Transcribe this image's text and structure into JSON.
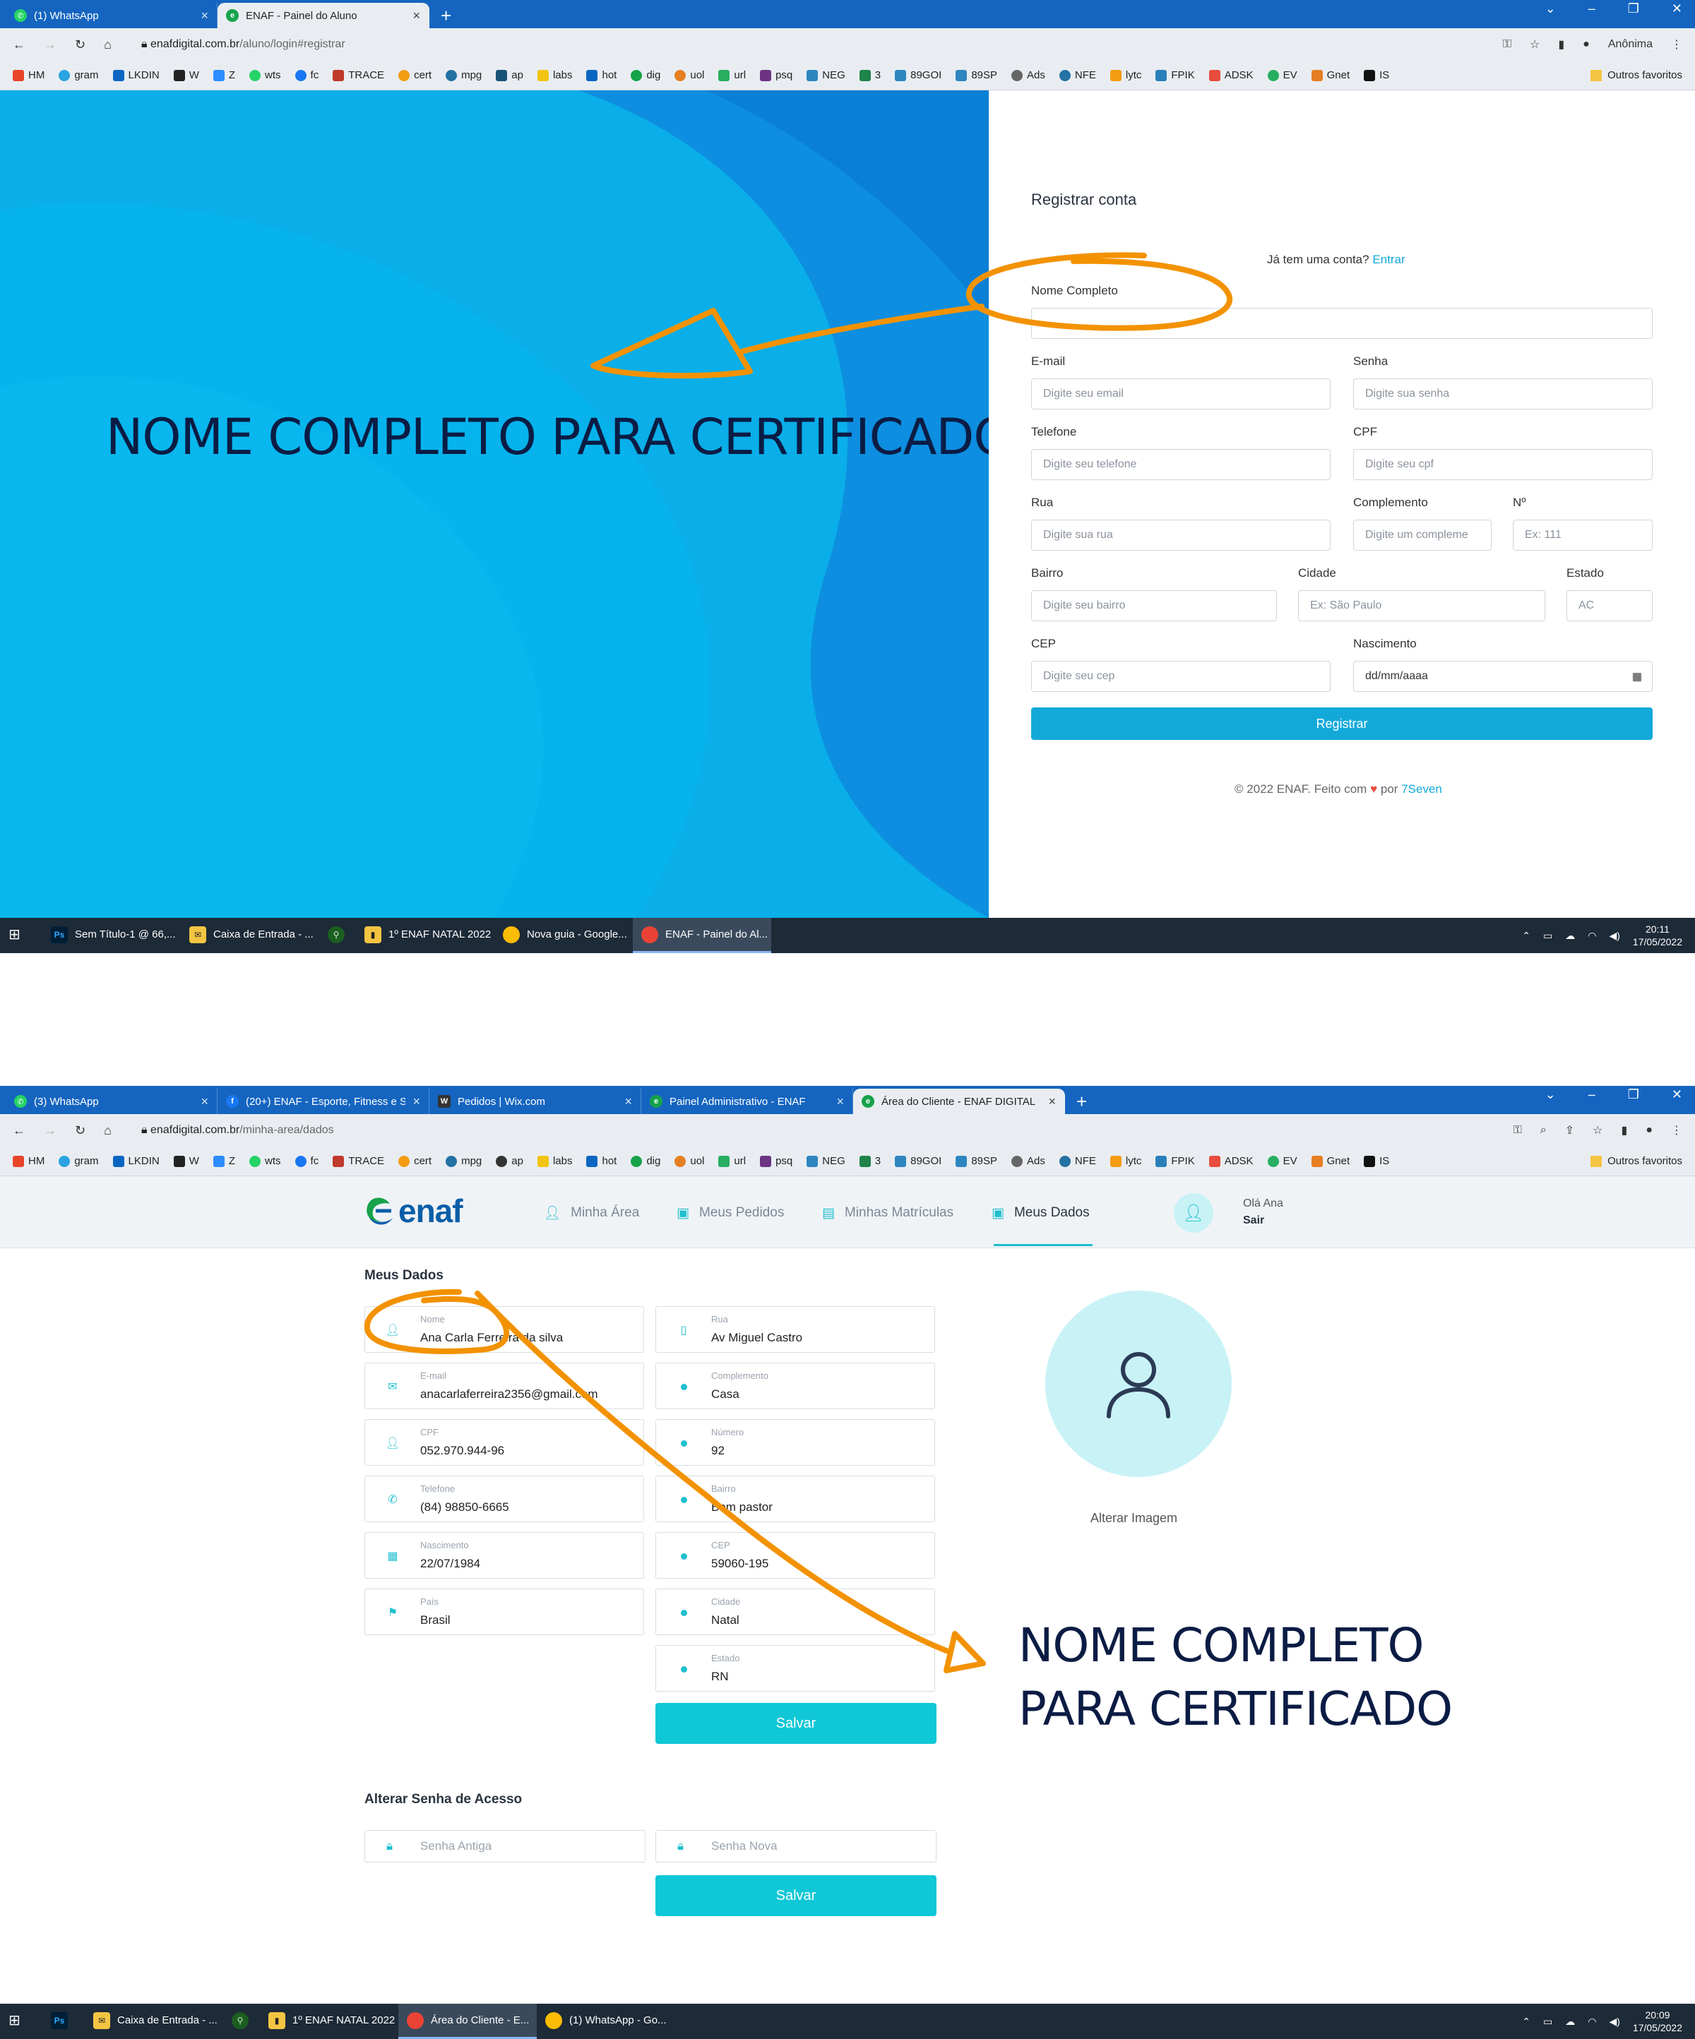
{
  "screenshot1": {
    "browser": {
      "tabs": [
        {
          "label": "(1) WhatsApp",
          "color": "#25d366"
        },
        {
          "label": "ENAF - Painel do Aluno",
          "color": "#16a34a"
        }
      ],
      "url_domain": "enafdigital.com.br",
      "url_path": "/aluno/login#registrar",
      "profile_label": "Anônima"
    },
    "form": {
      "title": "Registrar conta",
      "have_account": "Já tem uma conta?",
      "login_link": "Entrar",
      "full_name_label": "Nome Completo",
      "email_label": "E-mail",
      "email_placeholder": "Digite seu email",
      "password_label": "Senha",
      "password_placeholder": "Digite sua senha",
      "phone_label": "Telefone",
      "phone_placeholder": "Digite seu telefone",
      "cpf_label": "CPF",
      "cpf_placeholder": "Digite seu cpf",
      "street_label": "Rua",
      "street_placeholder": "Digite sua rua",
      "complement_label": "Complemento",
      "complement_placeholder": "Digite um compleme",
      "number_label": "Nº",
      "number_placeholder": "Ex: 111",
      "district_label": "Bairro",
      "district_placeholder": "Digite seu bairro",
      "city_label": "Cidade",
      "city_placeholder": "Ex: São Paulo",
      "state_label": "Estado",
      "state_value": "AC",
      "cep_label": "CEP",
      "cep_placeholder": "Digite seu cep",
      "birth_label": "Nascimento",
      "birth_placeholder": "dd/mm/aaaa",
      "submit_label": "Registrar",
      "footer_prefix": "© 2022 ENAF. Feito com",
      "footer_by": "por",
      "footer_link": "7Seven"
    },
    "annotation_text": "NOME COMPLETO PARA CERTIFICADO",
    "taskbar": {
      "items": [
        "Sem Título-1 @ 66,...",
        "Caixa de Entrada - ...",
        "",
        "1º ENAF NATAL 2022",
        "Nova guia - Google...",
        "ENAF - Painel do Al..."
      ],
      "time": "20:11",
      "date": "17/05/2022"
    }
  },
  "screenshot2": {
    "browser": {
      "tabs": [
        {
          "label": "(3) WhatsApp",
          "color": "#25d366"
        },
        {
          "label": "(20+) ENAF - Esporte, Fitness e S",
          "color": "#1877f2"
        },
        {
          "label": "Pedidos | Wix.com",
          "color": "#333333"
        },
        {
          "label": "Painel Administrativo - ENAF",
          "color": "#16a34a"
        },
        {
          "label": "Área do Cliente - ENAF DIGITAL",
          "color": "#16a34a"
        }
      ],
      "url_domain": "enafdigital.com.br",
      "url_path": "/minha-area/dados"
    },
    "site": {
      "logo": "enaf",
      "nav": [
        "Minha Área",
        "Meus Pedidos",
        "Minhas Matrículas",
        "Meus Dados"
      ],
      "greeting": "Olá Ana",
      "logout": "Sair"
    },
    "my_data": {
      "title": "Meus Dados",
      "left_fields": [
        {
          "label": "Nome",
          "value": "Ana Carla Ferreira da silva",
          "icon": "user-icon"
        },
        {
          "label": "E-mail",
          "value": "anacarlaferreira2356@gmail.com",
          "icon": "mail-icon"
        },
        {
          "label": "CPF",
          "value": "052.970.944-96",
          "icon": "user-icon"
        },
        {
          "label": "Telefone",
          "value": "(84) 98850-6665",
          "icon": "phone-icon"
        },
        {
          "label": "Nascimento",
          "value": "22/07/1984",
          "icon": "calendar-icon"
        },
        {
          "label": "País",
          "value": "Brasil",
          "icon": "flag-icon"
        }
      ],
      "right_fields": [
        {
          "label": "Rua",
          "value": "Av Miguel Castro",
          "icon": "building-icon"
        },
        {
          "label": "Complemento",
          "value": "Casa",
          "icon": "dot-icon"
        },
        {
          "label": "Número",
          "value": "92",
          "icon": "dot-icon"
        },
        {
          "label": "Bairro",
          "value": "Bom pastor",
          "icon": "dot-icon"
        },
        {
          "label": "CEP",
          "value": "59060-195",
          "icon": "dot-icon"
        },
        {
          "label": "Cidade",
          "value": "Natal",
          "icon": "dot-icon"
        },
        {
          "label": "Estado",
          "value": "RN",
          "icon": "dot-icon"
        }
      ],
      "save_label": "Salvar",
      "change_image": "Alterar Imagem"
    },
    "password": {
      "title": "Alterar Senha de Acesso",
      "old_placeholder": "Senha Antiga",
      "new_placeholder": "Senha Nova",
      "save_label": "Salvar"
    },
    "annotation_line1": "NOME COMPLETO",
    "annotation_line2": "PARA CERTIFICADO",
    "taskbar": {
      "items": [
        "",
        "Caixa de Entrada - ...",
        "",
        "1º ENAF NATAL 2022",
        "Área do Cliente - E...",
        "(1) WhatsApp - Go..."
      ],
      "time": "20:09",
      "date": "17/05/2022"
    }
  },
  "colors": {
    "chrome_blue": "#1565c0",
    "brand_teal": "#0fc7d6",
    "register_blue": "#12a9d9",
    "annotation_orange": "#f39200",
    "heading_navy": "#0b1c44"
  }
}
